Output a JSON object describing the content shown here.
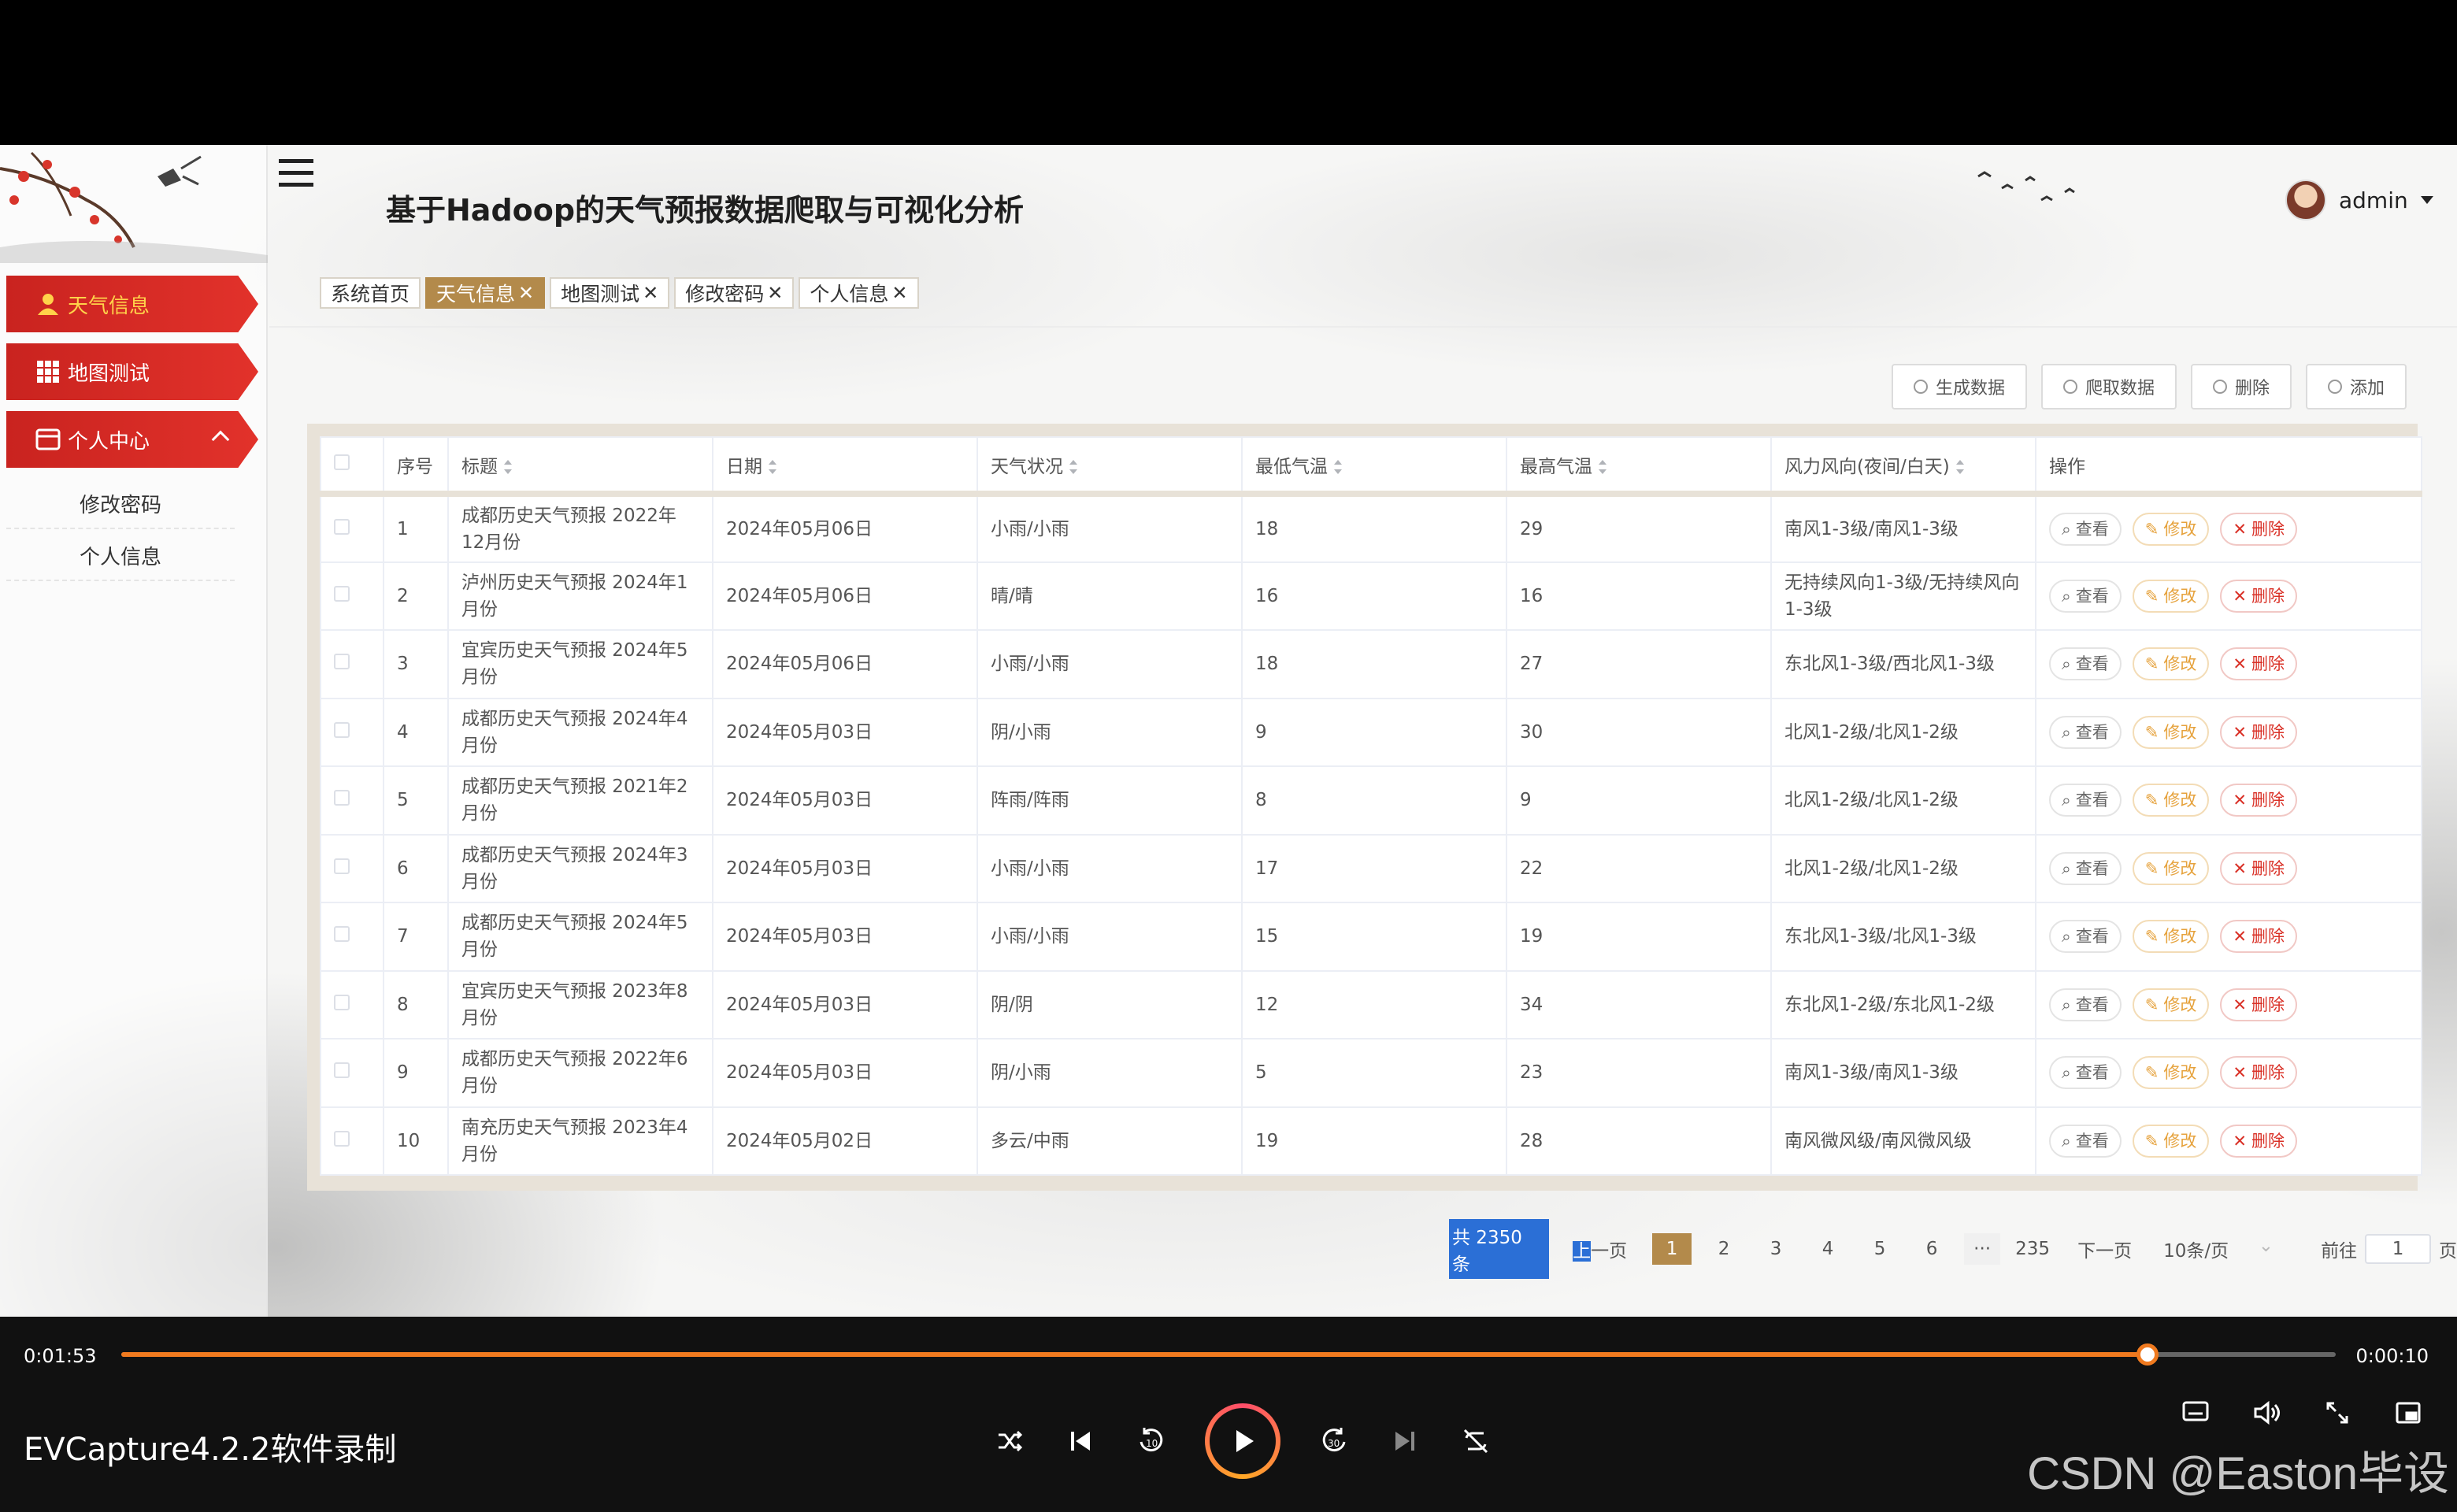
{
  "app": {
    "title": "基于Hadoop的天气预报数据爬取与可视化分析",
    "user": "admin"
  },
  "sidebar": {
    "items": [
      {
        "label": "天气信息",
        "icon": "user-icon",
        "active": true
      },
      {
        "label": "地图测试",
        "icon": "grid-icon",
        "active": false
      },
      {
        "label": "个人中心",
        "icon": "card-icon",
        "active": false,
        "expanded": true
      }
    ],
    "sub_items": [
      "修改密码",
      "个人信息"
    ]
  },
  "tabs": [
    {
      "label": "系统首页",
      "closable": false,
      "active": false
    },
    {
      "label": "天气信息",
      "closable": true,
      "active": true
    },
    {
      "label": "地图测试",
      "closable": true,
      "active": false
    },
    {
      "label": "修改密码",
      "closable": true,
      "active": false
    },
    {
      "label": "个人信息",
      "closable": true,
      "active": false
    }
  ],
  "actions": [
    "生成数据",
    "爬取数据",
    "删除",
    "添加"
  ],
  "table": {
    "columns": [
      "序号",
      "标题",
      "日期",
      "天气状况",
      "最低气温",
      "最高气温",
      "风力风向(夜间/白天)",
      "操作"
    ],
    "op_labels": {
      "view": "查看",
      "edit": "修改",
      "del": "删除"
    },
    "rows": [
      [
        "1",
        "成都历史天气预报 2022年12月份",
        "2024年05月06日",
        "小雨/小雨",
        "18",
        "29",
        "南风1-3级/南风1-3级"
      ],
      [
        "2",
        "泸州历史天气预报 2024年1月份",
        "2024年05月06日",
        "晴/晴",
        "16",
        "16",
        "无持续风向1-3级/无持续风向1-3级"
      ],
      [
        "3",
        "宜宾历史天气预报 2024年5月份",
        "2024年05月06日",
        "小雨/小雨",
        "18",
        "27",
        "东北风1-3级/西北风1-3级"
      ],
      [
        "4",
        "成都历史天气预报 2024年4月份",
        "2024年05月03日",
        "阴/小雨",
        "9",
        "30",
        "北风1-2级/北风1-2级"
      ],
      [
        "5",
        "成都历史天气预报 2021年2月份",
        "2024年05月03日",
        "阵雨/阵雨",
        "8",
        "9",
        "北风1-2级/北风1-2级"
      ],
      [
        "6",
        "成都历史天气预报 2024年3月份",
        "2024年05月03日",
        "小雨/小雨",
        "17",
        "22",
        "北风1-2级/北风1-2级"
      ],
      [
        "7",
        "成都历史天气预报 2024年5月份",
        "2024年05月03日",
        "小雨/小雨",
        "15",
        "19",
        "东北风1-3级/北风1-3级"
      ],
      [
        "8",
        "宜宾历史天气预报 2023年8月份",
        "2024年05月03日",
        "阴/阴",
        "12",
        "34",
        "东北风1-2级/东北风1-2级"
      ],
      [
        "9",
        "成都历史天气预报 2022年6月份",
        "2024年05月03日",
        "阴/小雨",
        "5",
        "23",
        "南风1-3级/南风1-3级"
      ],
      [
        "10",
        "南充历史天气预报 2023年4月份",
        "2024年05月02日",
        "多云/中雨",
        "19",
        "28",
        "南风微风级/南风微风级"
      ]
    ]
  },
  "pagination": {
    "total": "共 2350 条",
    "prev_a": "上",
    "prev_b": "一页",
    "pages": [
      "1",
      "2",
      "3",
      "4",
      "5",
      "6"
    ],
    "more": "···",
    "last": "235",
    "next": "下一页",
    "page_size": "10条/页",
    "goto_prefix": "前往",
    "goto_value": "1",
    "goto_suffix": "页"
  },
  "player": {
    "current_time": "0:01:53",
    "end_time": "0:00:10",
    "progress": 0.915,
    "recorder_label": "EVCapture4.2.2软件录制",
    "watermark": "CSDN @Easton毕设",
    "accent": "#f07a1f"
  }
}
